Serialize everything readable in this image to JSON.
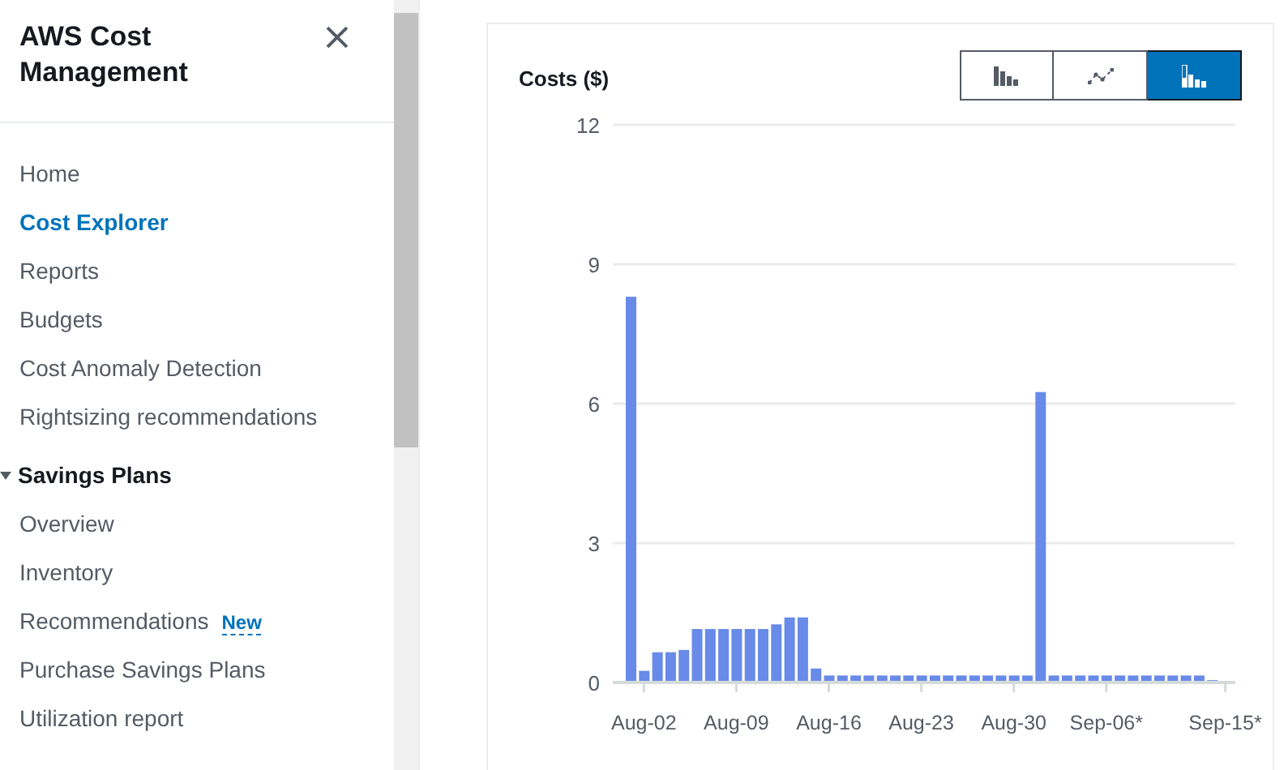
{
  "sidebar": {
    "title": "AWS Cost Management",
    "items": [
      {
        "label": "Home",
        "selected": false
      },
      {
        "label": "Cost Explorer",
        "selected": true
      },
      {
        "label": "Reports",
        "selected": false
      },
      {
        "label": "Budgets",
        "selected": false
      },
      {
        "label": "Cost Anomaly Detection",
        "selected": false
      },
      {
        "label": "Rightsizing recommendations",
        "selected": false
      }
    ],
    "sections": [
      {
        "label": "Savings Plans",
        "expanded": true,
        "children": [
          {
            "label": "Overview",
            "selected": false
          },
          {
            "label": "Inventory",
            "selected": false
          },
          {
            "label": "Recommendations",
            "selected": false,
            "badge": "New"
          },
          {
            "label": "Purchase Savings Plans",
            "selected": false
          },
          {
            "label": "Utilization report",
            "selected": false
          }
        ]
      }
    ]
  },
  "chart_panel": {
    "title": "Costs ($)",
    "view_buttons": [
      {
        "kind": "bar",
        "selected": false
      },
      {
        "kind": "line",
        "selected": false
      },
      {
        "kind": "stacked",
        "selected": true
      }
    ],
    "chart_data": {
      "type": "bar",
      "grid": true,
      "categories": [
        null,
        "Aug-02",
        null,
        null,
        null,
        null,
        null,
        null,
        "Aug-09",
        null,
        null,
        null,
        null,
        null,
        null,
        "Aug-16",
        null,
        null,
        null,
        null,
        null,
        null,
        "Aug-23",
        null,
        null,
        null,
        null,
        null,
        null,
        "Aug-30",
        null,
        null,
        null,
        null,
        null,
        null,
        "Sep-06*",
        null,
        null,
        null,
        null,
        null,
        null,
        null,
        null,
        "Sep-15*"
      ],
      "series": [
        {
          "color": "#688ae8",
          "values": [
            8.3,
            0.25,
            0.65,
            0.65,
            0.7,
            1.15,
            1.15,
            1.15,
            1.15,
            1.15,
            1.15,
            1.25,
            1.4,
            1.4,
            0.3,
            0.15,
            0.15,
            0.15,
            0.15,
            0.15,
            0.15,
            0.15,
            0.15,
            0.15,
            0.15,
            0.15,
            0.15,
            0.15,
            0.15,
            0.15,
            0.15,
            6.25,
            0.15,
            0.15,
            0.15,
            0.15,
            0.15,
            0.15,
            0.15,
            0.15,
            0.15,
            0.15,
            0.15,
            0.15,
            0.05,
            null
          ]
        }
      ],
      "ylim": [
        0,
        12
      ],
      "yticks": [
        0,
        3,
        6,
        9,
        12
      ]
    }
  }
}
